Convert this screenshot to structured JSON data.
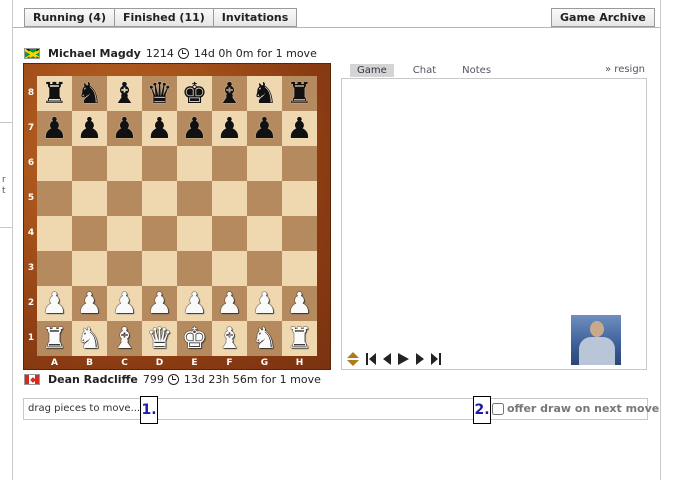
{
  "tabs": [
    {
      "label": "Running (4)"
    },
    {
      "label": "Finished (11)"
    },
    {
      "label": "Invitations"
    }
  ],
  "archive_tab": {
    "label": "Game Archive"
  },
  "edge_text": {
    "a": "r",
    "b": "t"
  },
  "top_player": {
    "name": "Michael Magdy",
    "rating": "1214",
    "time": "14d 0h 0m for 1 move",
    "flag": "jamaica-flag-icon"
  },
  "bottom_player": {
    "name": "Dean Radcliffe",
    "rating": "799",
    "time": "13d 23h 56m for 1 move",
    "flag": "canada-flag-icon"
  },
  "board": {
    "ranks": [
      "8",
      "7",
      "6",
      "5",
      "4",
      "3",
      "2",
      "1"
    ],
    "files": [
      "A",
      "B",
      "C",
      "D",
      "E",
      "F",
      "G",
      "H"
    ],
    "rows": [
      [
        "bR",
        "bN",
        "bB",
        "bQ",
        "bK",
        "bB",
        "bN",
        "bR"
      ],
      [
        "bP",
        "bP",
        "bP",
        "bP",
        "bP",
        "bP",
        "bP",
        "bP"
      ],
      [
        "",
        "",
        "",
        "",
        "",
        "",
        "",
        ""
      ],
      [
        "",
        "",
        "",
        "",
        "",
        "",
        "",
        ""
      ],
      [
        "",
        "",
        "",
        "",
        "",
        "",
        "",
        ""
      ],
      [
        "",
        "",
        "",
        "",
        "",
        "",
        "",
        ""
      ],
      [
        "wP",
        "wP",
        "wP",
        "wP",
        "wP",
        "wP",
        "wP",
        "wP"
      ],
      [
        "wR",
        "wN",
        "wB",
        "wQ",
        "wK",
        "wB",
        "wN",
        "wR"
      ]
    ]
  },
  "panel_tabs": [
    {
      "label": "Game"
    },
    {
      "label": "Chat"
    },
    {
      "label": "Notes"
    }
  ],
  "resign_label": "» resign",
  "nav_icons": [
    "flip-board-icon",
    "first-move-icon",
    "previous-move-icon",
    "play-icon",
    "next-move-icon",
    "last-move-icon"
  ],
  "move_input": {
    "text": "drag pieces to move..."
  },
  "steps": {
    "one": "1.",
    "two": "2."
  },
  "draw_offer": {
    "label": "offer draw on next move",
    "checked": false
  }
}
